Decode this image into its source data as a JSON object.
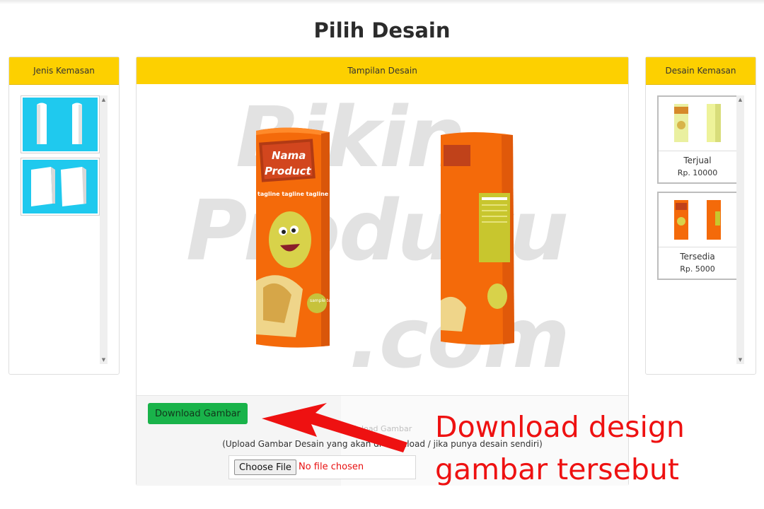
{
  "page": {
    "title": "Pilih Desain"
  },
  "left_panel": {
    "title": "Jenis Kemasan",
    "items": [
      {
        "label": "Tabung"
      },
      {
        "label": "Kotak"
      }
    ]
  },
  "center_panel": {
    "title": "Tampilan Desain",
    "watermark": [
      "Bikin",
      "Produku",
      ".com"
    ],
    "product": {
      "name_line1": "Nama",
      "name_line2": "Product",
      "tagline": "tagline tagline tagline tagline",
      "flavor": "sample text"
    },
    "download_button": "Download Gambar",
    "upload_label": "Upload Gambar",
    "upload_hint": "(Upload Gambar Desain yang akan di download / jika punya desain sendiri)",
    "file_input": {
      "button": "Choose File",
      "status": "No file chosen"
    }
  },
  "right_panel": {
    "title": "Desain Kemasan",
    "items": [
      {
        "name": "Terjual",
        "price": "Rp. 10000"
      },
      {
        "name": "Tersedia",
        "price": "Rp. 5000"
      }
    ]
  },
  "annotation": {
    "line1": "Download design",
    "line2": "gambar tersebut"
  },
  "colors": {
    "header_yellow": "#fdd000",
    "button_green": "#19b34a",
    "package_orange": "#f46a0a",
    "thumb_cyan": "#1fc9ee",
    "annotation_red": "#ee1111"
  }
}
